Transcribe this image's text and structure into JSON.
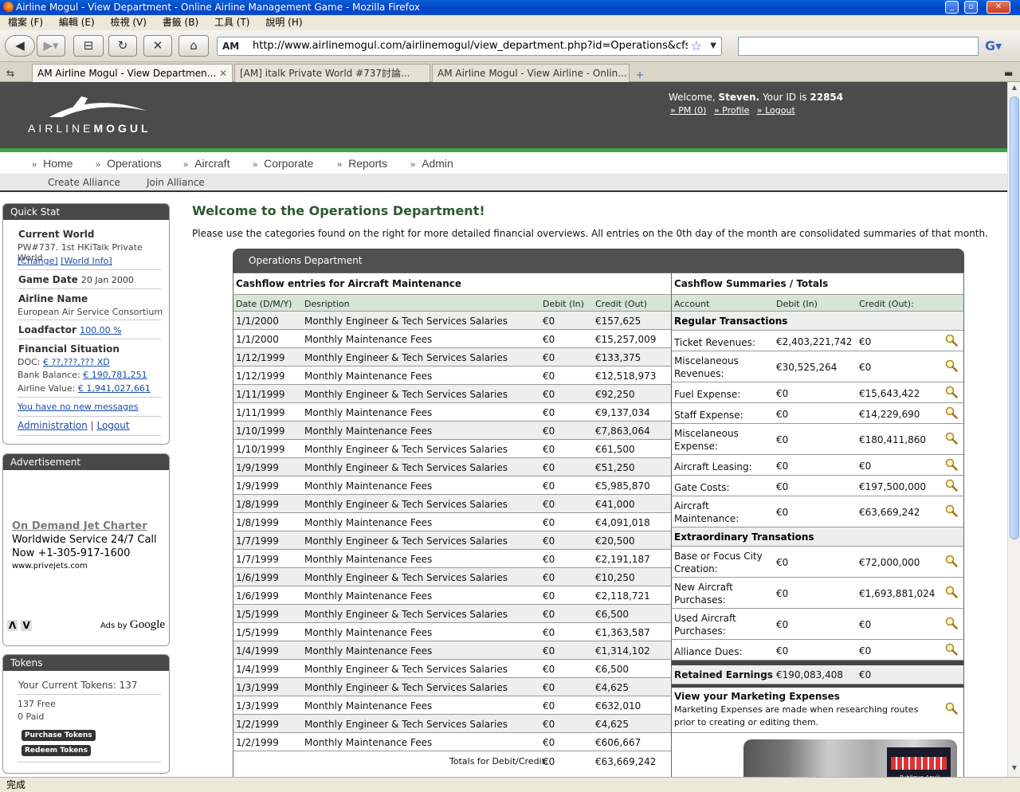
{
  "browser": {
    "window_title": "Airline Mogul - View Department - Online Airline Management Game - Mozilla Firefox",
    "menus": [
      "檔案 (F)",
      "編輯 (E)",
      "檢視 (V)",
      "書籤 (B)",
      "工具 (T)",
      "說明 (H)"
    ],
    "url": "http://www.airlinemogul.com/airlinemogul/view_department.php?id=Operations&cfs=Aircraft M",
    "url_favicon": "AM",
    "tabs": [
      {
        "label": "AM Airline Mogul - View Departmen..."
      },
      {
        "label": "[AM] italk Private World #737討論..."
      },
      {
        "label": "AM Airline Mogul - View Airline - Onlin..."
      }
    ],
    "status": "完成"
  },
  "site": {
    "logo_prefix": "AIRLINE",
    "logo_suffix": "MOGUL",
    "welcome_prefix": "Welcome, ",
    "user_name": "Steven.",
    "id_prefix": " Your ID is ",
    "user_id": "22854",
    "user_links": [
      "» PM (0)",
      "» Profile",
      "» Logout"
    ],
    "nav": [
      "Home",
      "Operations",
      "Aircraft",
      "Corporate",
      "Reports",
      "Admin"
    ],
    "subnav": [
      "Create Alliance",
      "Join Alliance"
    ]
  },
  "quickstat": {
    "title": "Quick Stat",
    "current_world_label": "Current World",
    "current_world_value": "PW#737.  1st HKiTalk Private World",
    "change_link": "[Change]",
    "worldinfo_link": "[World Info]",
    "game_date_label": "Game Date",
    "game_date_value": "20 Jan 2000",
    "airline_name_label": "Airline Name",
    "airline_name_value": "European Air Service Consortium",
    "loadfactor_label": "Loadfactor",
    "loadfactor_value": "100.00 %",
    "financial_label": "Financial Situation",
    "doc_label": "DOC:",
    "doc_value": "€ ??,???,??? XD",
    "bank_label": "Bank Balance:",
    "bank_value": "€ 190,781,251",
    "airline_value_label": "Airline Value:",
    "airline_value_value": "€ 1,941,027,661",
    "messages": "You have no new messages",
    "admin_link": "Administration",
    "logout_link": "Logout"
  },
  "advert": {
    "title": "Advertisement",
    "headline": "On Demand Jet Charter",
    "line1": "Worldwide Service 24/7 Call",
    "line2": "Now +1-305-917-1600",
    "url": "www.privejets.com",
    "ads_by": "Ads by",
    "google": "Google"
  },
  "tokens": {
    "title": "Tokens",
    "current": "Your Current Tokens: 137",
    "free": "137 Free",
    "paid": "0 Paid",
    "purchase": "Purchase Tokens",
    "redeem": "Redeem Tokens"
  },
  "main": {
    "title": "Welcome to the Operations Department!",
    "intro": "Please use the categories found on the right for more detailed financial overviews. All entries on the 0th day of the month are consolidated summaries of that month.",
    "panel_title": "Operations Department",
    "left_heading": "Cashflow entries for Aircraft Maintenance",
    "left_cols": [
      "Date (D/M/Y)",
      "Desription",
      "Debit (In)",
      "Credit (Out)"
    ],
    "entries": [
      [
        "1/1/2000",
        "Monthly Engineer & Tech Services Salaries",
        "€0",
        "€157,625"
      ],
      [
        "1/1/2000",
        "Monthly Maintenance Fees",
        "€0",
        "€15,257,009"
      ],
      [
        "1/12/1999",
        "Monthly Engineer & Tech Services Salaries",
        "€0",
        "€133,375"
      ],
      [
        "1/12/1999",
        "Monthly Maintenance Fees",
        "€0",
        "€12,518,973"
      ],
      [
        "1/11/1999",
        "Monthly Engineer & Tech Services Salaries",
        "€0",
        "€92,250"
      ],
      [
        "1/11/1999",
        "Monthly Maintenance Fees",
        "€0",
        "€9,137,034"
      ],
      [
        "1/10/1999",
        "Monthly Maintenance Fees",
        "€0",
        "€7,863,064"
      ],
      [
        "1/10/1999",
        "Monthly Engineer & Tech Services Salaries",
        "€0",
        "€61,500"
      ],
      [
        "1/9/1999",
        "Monthly Engineer & Tech Services Salaries",
        "€0",
        "€51,250"
      ],
      [
        "1/9/1999",
        "Monthly Maintenance Fees",
        "€0",
        "€5,985,870"
      ],
      [
        "1/8/1999",
        "Monthly Engineer & Tech Services Salaries",
        "€0",
        "€41,000"
      ],
      [
        "1/8/1999",
        "Monthly Maintenance Fees",
        "€0",
        "€4,091,018"
      ],
      [
        "1/7/1999",
        "Monthly Engineer & Tech Services Salaries",
        "€0",
        "€20,500"
      ],
      [
        "1/7/1999",
        "Monthly Maintenance Fees",
        "€0",
        "€2,191,187"
      ],
      [
        "1/6/1999",
        "Monthly Engineer & Tech Services Salaries",
        "€0",
        "€10,250"
      ],
      [
        "1/6/1999",
        "Monthly Maintenance Fees",
        "€0",
        "€2,118,721"
      ],
      [
        "1/5/1999",
        "Monthly Engineer & Tech Services Salaries",
        "€0",
        "€6,500"
      ],
      [
        "1/5/1999",
        "Monthly Maintenance Fees",
        "€0",
        "€1,363,587"
      ],
      [
        "1/4/1999",
        "Monthly Maintenance Fees",
        "€0",
        "€1,314,102"
      ],
      [
        "1/4/1999",
        "Monthly Engineer & Tech Services Salaries",
        "€0",
        "€6,500"
      ],
      [
        "1/3/1999",
        "Monthly Engineer & Tech Services Salaries",
        "€0",
        "€4,625"
      ],
      [
        "1/3/1999",
        "Monthly Maintenance Fees",
        "€0",
        "€632,010"
      ],
      [
        "1/2/1999",
        "Monthly Engineer & Tech Services Salaries",
        "€0",
        "€4,625"
      ],
      [
        "1/2/1999",
        "Monthly Maintenance Fees",
        "€0",
        "€606,667"
      ]
    ],
    "totals_label": "Totals for Debit/Credit:",
    "totals_debit": "€0",
    "totals_credit": "€63,669,242",
    "right_heading": "Cashflow Summaries / Totals",
    "right_cols": [
      "Account",
      "Debit (In)",
      "Credit (Out):"
    ],
    "regular_heading": "Regular Transactions",
    "regular": [
      [
        "Ticket Revenues:",
        "€2,403,221,742",
        "€0"
      ],
      [
        "Miscelaneous Revenues:",
        "€30,525,264",
        "€0"
      ],
      [
        "Fuel Expense:",
        "€0",
        "€15,643,422"
      ],
      [
        "Staff Expense:",
        "€0",
        "€14,229,690"
      ],
      [
        "Miscelaneous Expense:",
        "€0",
        "€180,411,860"
      ],
      [
        "Aircraft Leasing:",
        "€0",
        "€0"
      ],
      [
        "Gate Costs:",
        "€0",
        "€197,500,000"
      ],
      [
        "Aircraft Maintenance:",
        "€0",
        "€63,669,242"
      ]
    ],
    "extra_heading": "Extraordinary Transations",
    "extra": [
      [
        "Base or Focus City Creation:",
        "€0",
        "€72,000,000"
      ],
      [
        "New Aircraft Purchases:",
        "€0",
        "€1,693,881,024"
      ],
      [
        "Used Aircraft Purchases:",
        "€0",
        "€0"
      ],
      [
        "Alliance Dues:",
        "€0",
        "€0"
      ]
    ],
    "retained_label": "Retained Earnings",
    "retained_debit": "€190,083,408",
    "retained_credit": "€0",
    "marketing_heading": "View your Marketing Expenses",
    "marketing_text": "Marketing Expenses are made when researching routes prior to creating or editing them.",
    "photo_sign": "Publique Aqui!"
  }
}
